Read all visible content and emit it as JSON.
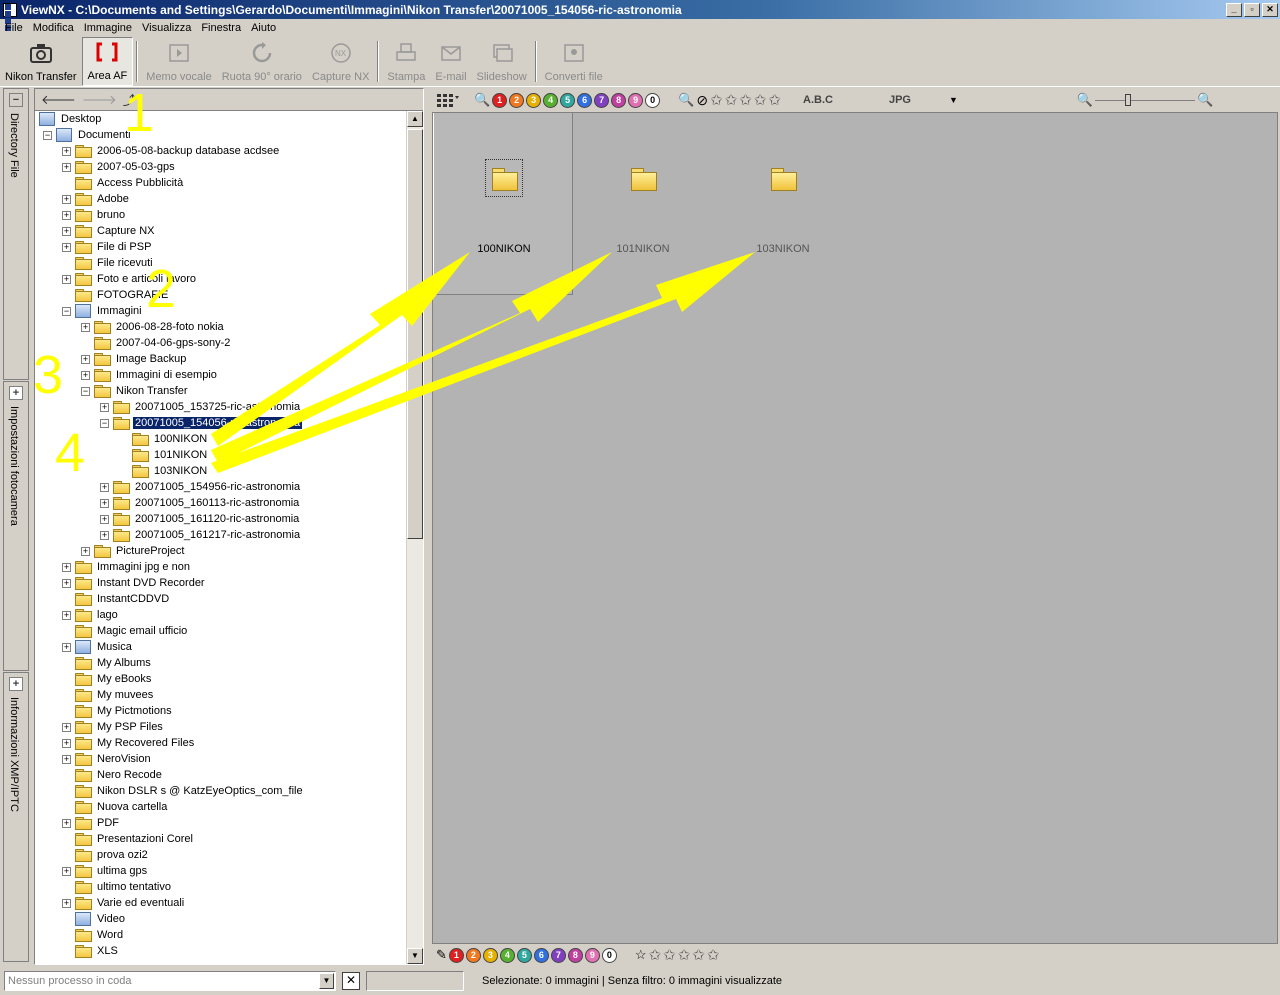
{
  "window": {
    "title": "ViewNX - C:\\Documents and Settings\\Gerardo\\Documenti\\Immagini\\Nikon Transfer\\20071005_154056-ric-astronomia",
    "minimize": "_",
    "maximize": "▫",
    "close": "✕"
  },
  "menu": [
    "File",
    "Modifica",
    "Immagine",
    "Visualizza",
    "Finestra",
    "Aiuto"
  ],
  "toolbar": {
    "tools": [
      {
        "label": "Nikon Transfer",
        "icon": "camera-icon"
      },
      {
        "label": "Area AF",
        "icon": "af-area-icon"
      },
      {
        "label": "Memo vocale",
        "icon": "voice-memo-icon"
      },
      {
        "label": "Ruota 90° orario",
        "icon": "rotate-icon"
      },
      {
        "label": "Capture NX",
        "icon": "capture-nx-icon"
      },
      {
        "label": "Stampa",
        "icon": "print-icon"
      },
      {
        "label": "E-mail",
        "icon": "email-icon"
      },
      {
        "label": "Slideshow",
        "icon": "slideshow-icon"
      },
      {
        "label": "Converti file",
        "icon": "convert-icon"
      }
    ]
  },
  "side_tabs": [
    "Directory File",
    "Impostazioni fotocamera",
    "Informazioni XMP/IPTC"
  ],
  "tree": {
    "nodes": [
      {
        "label": "Desktop",
        "depth": 0,
        "exp": "none",
        "icon": "special"
      },
      {
        "label": "Documenti",
        "depth": 1,
        "exp": "minus",
        "icon": "special"
      },
      {
        "label": "2006-05-08-backup database acdsee",
        "depth": 2,
        "exp": "plus"
      },
      {
        "label": "2007-05-03-gps",
        "depth": 2,
        "exp": "plus"
      },
      {
        "label": "Access Pubblicità",
        "depth": 2,
        "exp": "none"
      },
      {
        "label": "Adobe",
        "depth": 2,
        "exp": "plus"
      },
      {
        "label": "bruno",
        "depth": 2,
        "exp": "plus"
      },
      {
        "label": "Capture NX",
        "depth": 2,
        "exp": "plus"
      },
      {
        "label": "File di PSP",
        "depth": 2,
        "exp": "plus"
      },
      {
        "label": "File ricevuti",
        "depth": 2,
        "exp": "none"
      },
      {
        "label": "Foto e articoli lavoro",
        "depth": 2,
        "exp": "plus"
      },
      {
        "label": "FOTOGRAFIE",
        "depth": 2,
        "exp": "none"
      },
      {
        "label": "Immagini",
        "depth": 2,
        "exp": "minus",
        "icon": "special"
      },
      {
        "label": "2006-08-28-foto nokia",
        "depth": 3,
        "exp": "plus"
      },
      {
        "label": "2007-04-06-gps-sony-2",
        "depth": 3,
        "exp": "none"
      },
      {
        "label": "Image Backup",
        "depth": 3,
        "exp": "plus"
      },
      {
        "label": "Immagini di esempio",
        "depth": 3,
        "exp": "plus"
      },
      {
        "label": "Nikon Transfer",
        "depth": 3,
        "exp": "minus"
      },
      {
        "label": "20071005_153725-ric-astronomia",
        "depth": 4,
        "exp": "plus"
      },
      {
        "label": "20071005_154056-ric-astronomia",
        "depth": 4,
        "exp": "minus",
        "selected": true
      },
      {
        "label": "100NIKON",
        "depth": 5,
        "exp": "none"
      },
      {
        "label": "101NIKON",
        "depth": 5,
        "exp": "none"
      },
      {
        "label": "103NIKON",
        "depth": 5,
        "exp": "none"
      },
      {
        "label": "20071005_154956-ric-astronomia",
        "depth": 4,
        "exp": "plus"
      },
      {
        "label": "20071005_160113-ric-astronomia",
        "depth": 4,
        "exp": "plus"
      },
      {
        "label": "20071005_161120-ric-astronomia",
        "depth": 4,
        "exp": "plus"
      },
      {
        "label": "20071005_161217-ric-astronomia",
        "depth": 4,
        "exp": "plus"
      },
      {
        "label": "PictureProject",
        "depth": 3,
        "exp": "plus"
      },
      {
        "label": "Immagini jpg e non",
        "depth": 2,
        "exp": "plus"
      },
      {
        "label": "Instant DVD Recorder",
        "depth": 2,
        "exp": "plus"
      },
      {
        "label": "InstantCDDVD",
        "depth": 2,
        "exp": "none"
      },
      {
        "label": "lago",
        "depth": 2,
        "exp": "plus"
      },
      {
        "label": "Magic email ufficio",
        "depth": 2,
        "exp": "none"
      },
      {
        "label": "Musica",
        "depth": 2,
        "exp": "plus",
        "icon": "special"
      },
      {
        "label": "My Albums",
        "depth": 2,
        "exp": "none"
      },
      {
        "label": "My eBooks",
        "depth": 2,
        "exp": "none"
      },
      {
        "label": "My muvees",
        "depth": 2,
        "exp": "none"
      },
      {
        "label": "My Pictmotions",
        "depth": 2,
        "exp": "none"
      },
      {
        "label": "My PSP Files",
        "depth": 2,
        "exp": "plus"
      },
      {
        "label": "My Recovered Files",
        "depth": 2,
        "exp": "plus"
      },
      {
        "label": "NeroVision",
        "depth": 2,
        "exp": "plus"
      },
      {
        "label": "Nero Recode",
        "depth": 2,
        "exp": "none"
      },
      {
        "label": "Nikon DSLR s @ KatzEyeOptics_com_file",
        "depth": 2,
        "exp": "none"
      },
      {
        "label": "Nuova cartella",
        "depth": 2,
        "exp": "none"
      },
      {
        "label": "PDF",
        "depth": 2,
        "exp": "plus"
      },
      {
        "label": "Presentazioni Corel",
        "depth": 2,
        "exp": "none"
      },
      {
        "label": "prova ozi2",
        "depth": 2,
        "exp": "none"
      },
      {
        "label": "ultima gps",
        "depth": 2,
        "exp": "plus"
      },
      {
        "label": "ultimo tentativo",
        "depth": 2,
        "exp": "none"
      },
      {
        "label": "Varie ed eventuali",
        "depth": 2,
        "exp": "plus"
      },
      {
        "label": "Video",
        "depth": 2,
        "exp": "none",
        "icon": "special"
      },
      {
        "label": "Word",
        "depth": 2,
        "exp": "none"
      },
      {
        "label": "XLS",
        "depth": 2,
        "exp": "none"
      }
    ]
  },
  "filter_toolbar": {
    "labels": [
      "1",
      "2",
      "3",
      "4",
      "5",
      "6",
      "7",
      "8",
      "9",
      "0"
    ],
    "label_colors": [
      "#e02020",
      "#f07820",
      "#e8b000",
      "#58b030",
      "#30a8a0",
      "#3070e0",
      "#8040c0",
      "#c040a0",
      "#e070b0",
      "#ffffff"
    ],
    "abc": "A.B.C",
    "format": "JPG"
  },
  "folders": [
    "100NIKON",
    "101NIKON",
    "103NIKON"
  ],
  "status": {
    "process_placeholder": "Nessun processo in coda",
    "message": "Selezionate: 0 immagini | Senza filtro: 0 immagini visualizzate"
  },
  "annotations": {
    "numbers": [
      "1",
      "2",
      "3",
      "4"
    ],
    "color": "#ffff00"
  }
}
